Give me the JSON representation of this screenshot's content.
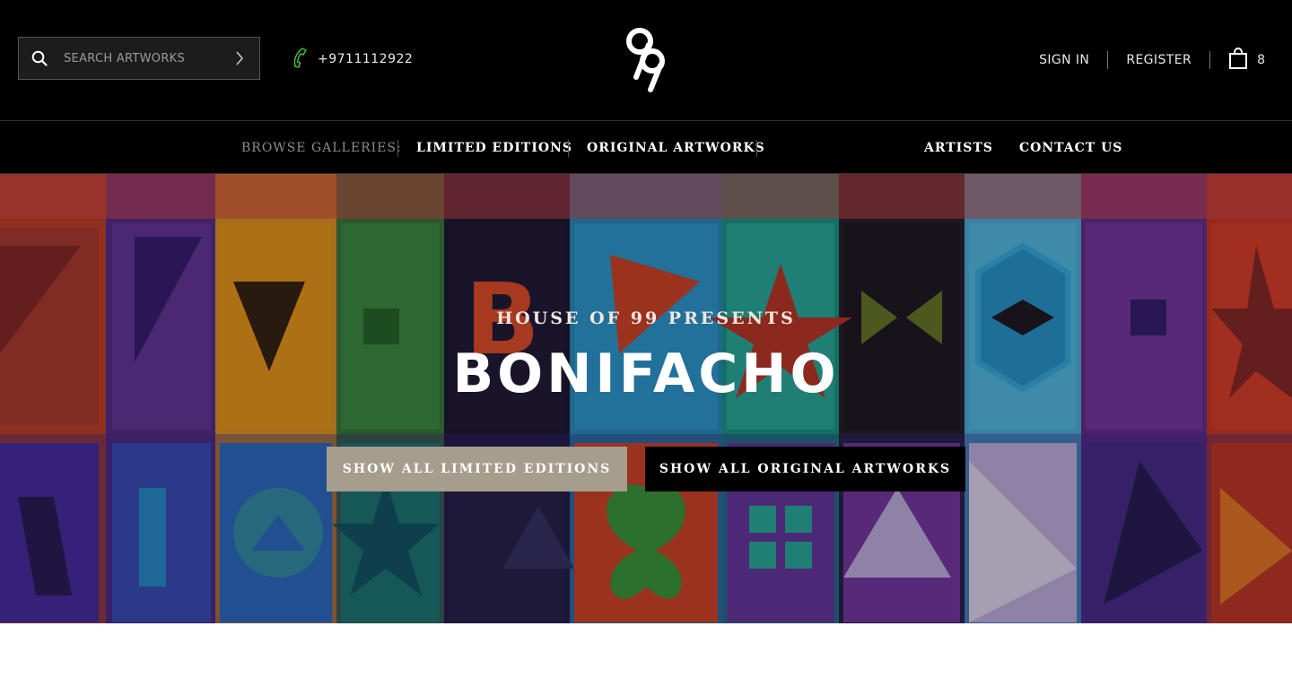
{
  "header": {
    "search": {
      "placeholder": "SEARCH ARTWORKS"
    },
    "phone": "+9711112922",
    "account": {
      "sign_in": "SIGN IN",
      "register": "REGISTER",
      "cart_count": "8"
    }
  },
  "nav": {
    "browse_label": "BROWSE GALLERIES:",
    "links": [
      "LIMITED EDITIONS",
      "ORIGINAL ARTWORKS",
      "ARTISTS",
      "CONTACT US"
    ]
  },
  "hero": {
    "eyebrow": "HOUSE OF 99 PRESENTS",
    "title": "BONIFACHO",
    "buttons": [
      "SHOW ALL LIMITED EDITIONS",
      "SHOW ALL ORIGINAL ARTWORKS"
    ]
  },
  "colors": {
    "header_bg": "#000000",
    "accent_green": "#3fbf3f",
    "limited_button": "#a79d8d",
    "original_button": "#000000"
  },
  "icons": [
    "search-icon",
    "chevron-right-icon",
    "phone-icon",
    "logo-99",
    "shopping-bag-icon"
  ]
}
